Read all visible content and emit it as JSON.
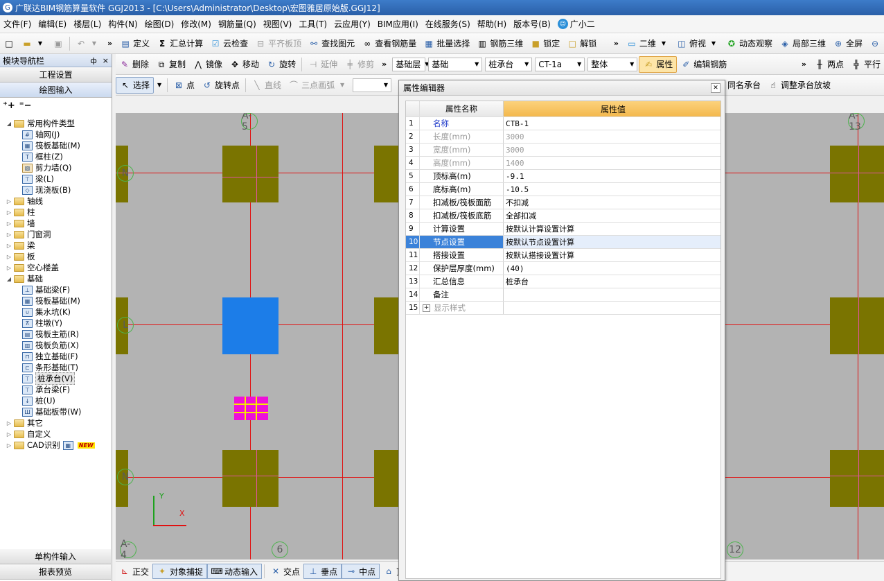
{
  "window": {
    "title": "广联达BIM钢筋算量软件 GGJ2013 - [C:\\Users\\Administrator\\Desktop\\宏图雅居原始版.GGJ12]"
  },
  "menu": {
    "items": [
      "文件(F)",
      "编辑(E)",
      "楼层(L)",
      "构件(N)",
      "绘图(D)",
      "修改(M)",
      "钢筋量(Q)",
      "视图(V)",
      "工具(T)",
      "云应用(Y)",
      "BIM应用(I)",
      "在线服务(S)",
      "帮助(H)",
      "版本号(B)"
    ],
    "helper": "广小二"
  },
  "toolbar1": {
    "define": "定义",
    "sum": "汇总计算",
    "cloud_check": "云检查",
    "flat_top": "平齐板顶",
    "find_element": "查找图元",
    "view_rebar": "查看钢筋量",
    "batch_select": "批量选择",
    "rebar_3d": "钢筋三维",
    "lock": "锁定",
    "unlock": "解锁",
    "view_2d": "二维",
    "top_view": "俯视",
    "dynamic_view": "动态观察",
    "local_3d": "局部三维",
    "fullscreen": "全屏"
  },
  "toolbar2": {
    "delete": "删除",
    "copy": "复制",
    "mirror": "镜像",
    "move": "移动",
    "rotate": "旋转",
    "extend": "延伸",
    "trim": "修剪",
    "floor": "基础层",
    "category": "基础",
    "type": "桩承台",
    "component": "CT-1a",
    "scope": "整体",
    "properties": "属性",
    "edit_rebar": "编辑钢筋",
    "two_points": "两点",
    "parallel": "平行"
  },
  "toolbar3": {
    "select": "选择",
    "point": "点",
    "rotate_point": "旋转点",
    "line": "直线",
    "arc": "三点画弧",
    "same_name_cap": "同名承台",
    "adjust_slope": "调整承台放坡"
  },
  "nav": {
    "title": "模块导航栏",
    "pin": "ф",
    "close": "×",
    "project_settings": "工程设置",
    "drawing_input": "绘图输入",
    "single_input": "单构件输入",
    "report_preview": "报表预览",
    "common_group": "常用构件类型",
    "common_items": [
      "轴网(J)",
      "筏板基础(M)",
      "框柱(Z)",
      "剪力墙(Q)",
      "梁(L)",
      "现浇板(B)"
    ],
    "groups_a": [
      "轴线",
      "柱",
      "墙",
      "门窗洞",
      "梁",
      "板",
      "空心楼盖"
    ],
    "foundation_group": "基础",
    "foundation_items": [
      "基础梁(F)",
      "筏板基础(M)",
      "集水坑(K)",
      "柱墩(Y)",
      "筏板主筋(R)",
      "筏板负筋(X)",
      "独立基础(F)",
      "条形基础(T)",
      "桩承台(V)",
      "承台梁(F)",
      "桩(U)",
      "基础板带(W)"
    ],
    "groups_b": [
      "其它",
      "自定义"
    ],
    "cad_group": "CAD识别",
    "new_badge": "NEW"
  },
  "canvas": {
    "axis_labels": [
      "A-5",
      "A-13",
      "N",
      "L",
      "N",
      "A-4",
      "6",
      "12"
    ],
    "axis_x": "X",
    "axis_y": "Y"
  },
  "statusbar": {
    "ortho": "正交",
    "snap": "对象捕捉",
    "dynamic_input": "动态输入",
    "intersection": "交点",
    "perpendicular": "垂点",
    "midpoint": "中点",
    "vertex": "顶"
  },
  "property_editor": {
    "title": "属性编辑器",
    "col_name": "属性名称",
    "col_value": "属性值",
    "rows": [
      {
        "num": "1",
        "name": "名称",
        "value": "CTB-1"
      },
      {
        "num": "2",
        "name": "长度(mm)",
        "value": "3000"
      },
      {
        "num": "3",
        "name": "宽度(mm)",
        "value": "3000"
      },
      {
        "num": "4",
        "name": "高度(mm)",
        "value": "1400"
      },
      {
        "num": "5",
        "name": "顶标高(m)",
        "value": "-9.1"
      },
      {
        "num": "6",
        "name": "底标高(m)",
        "value": "-10.5"
      },
      {
        "num": "7",
        "name": "扣减板/筏板面筋",
        "value": "不扣减"
      },
      {
        "num": "8",
        "name": "扣减板/筏板底筋",
        "value": "全部扣减"
      },
      {
        "num": "9",
        "name": "计算设置",
        "value": "按默认计算设置计算"
      },
      {
        "num": "10",
        "name": "节点设置",
        "value": "按默认节点设置计算"
      },
      {
        "num": "11",
        "name": "搭接设置",
        "value": "按默认搭接设置计算"
      },
      {
        "num": "12",
        "name": "保护层厚度(mm)",
        "value": "(40)"
      },
      {
        "num": "13",
        "name": "汇总信息",
        "value": "桩承台"
      },
      {
        "num": "14",
        "name": "备注",
        "value": ""
      },
      {
        "num": "15",
        "name": "显示样式",
        "value": ""
      }
    ]
  },
  "colors": {
    "grid_line": "#e11010",
    "pile_cap": "#7a7400",
    "selected_cap": "#1c7de8",
    "canvas_bg": "#b3b3b3",
    "header_accent": "#f3b84d"
  }
}
